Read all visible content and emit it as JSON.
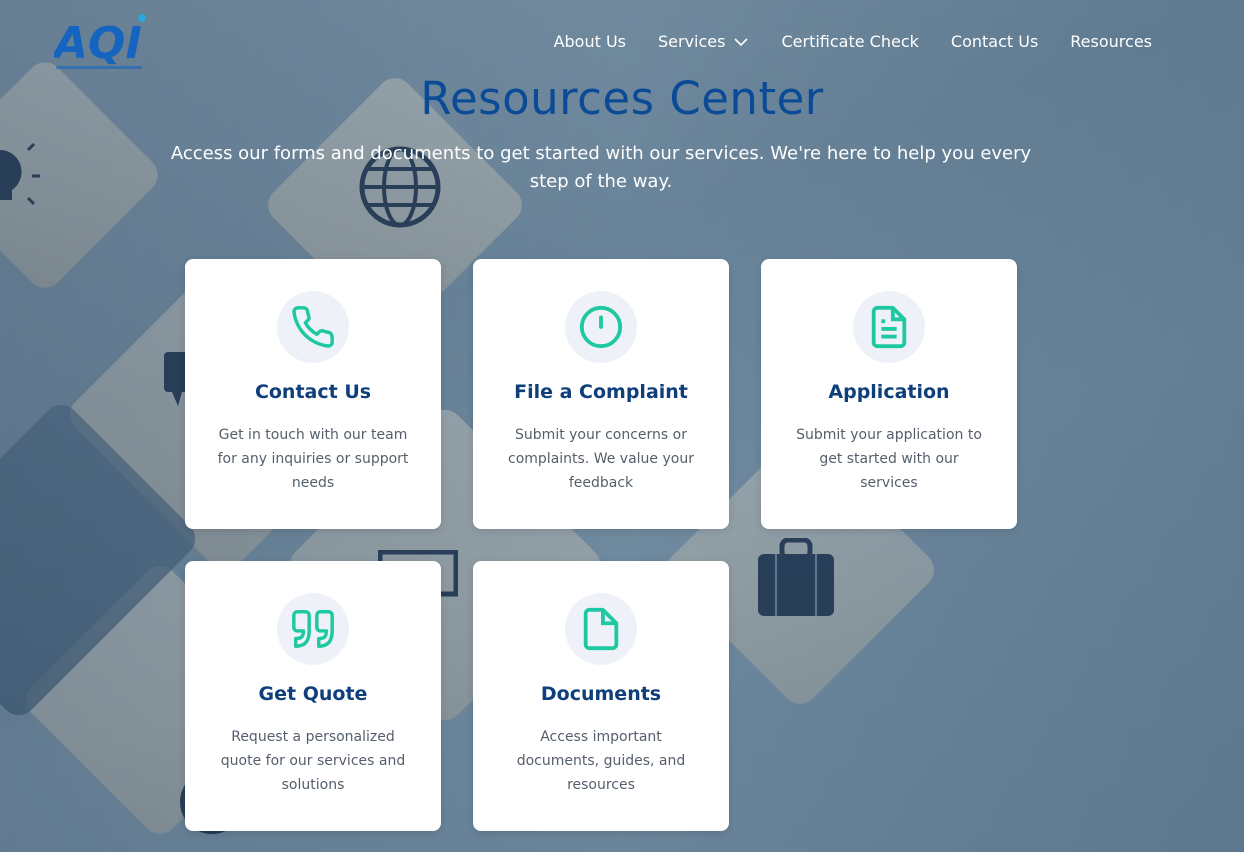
{
  "brand": {
    "logo_text": "AQI",
    "accent": "#1ec8a0",
    "primary": "#0a4a96"
  },
  "nav": {
    "items": [
      {
        "label": "About Us"
      },
      {
        "label": "Services"
      },
      {
        "label": "Certificate Check"
      },
      {
        "label": "Contact Us"
      },
      {
        "label": "Resources"
      }
    ]
  },
  "hero": {
    "title": "Resources Center",
    "subtitle": "Access our forms and documents to get started with our services. We're here to help you every step of the way."
  },
  "cards": [
    {
      "icon": "phone-icon",
      "title": "Contact Us",
      "description": "Get in touch with our team for any inquiries or support needs"
    },
    {
      "icon": "alert-circle-icon",
      "title": "File a Complaint",
      "description": "Submit your concerns or complaints. We value your feedback"
    },
    {
      "icon": "document-text-icon",
      "title": "Application",
      "description": "Submit your application to get started with our services"
    },
    {
      "icon": "quote-icon",
      "title": "Get Quote",
      "description": "Request a personalized quote for our services and solutions"
    },
    {
      "icon": "file-icon",
      "title": "Documents",
      "description": "Access important documents, guides, and resources"
    }
  ]
}
